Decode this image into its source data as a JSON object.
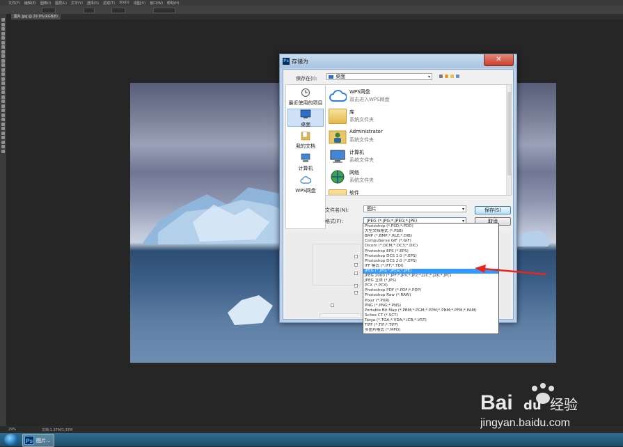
{
  "photoshop": {
    "menus": [
      "文件(F)",
      "编辑(E)",
      "图像(I)",
      "图层(L)",
      "文字(Y)",
      "选择(S)",
      "滤镜(T)",
      "3D(D)",
      "视图(V)",
      "窗口(W)",
      "帮助(H)"
    ],
    "doc_tab": "图片.jpg @ 29.9%(RGB/8)",
    "status_zoom": "29%",
    "status_doc": "文档:1.37M/1.37M"
  },
  "dialog": {
    "title": "存储为",
    "close_glyph": "✕",
    "save_in_label": "保存在(I):",
    "save_in_value": "桌面",
    "places": [
      {
        "label": "最近使用的项目",
        "icon": "recent-icon"
      },
      {
        "label": "桌面",
        "icon": "desktop-icon"
      },
      {
        "label": "我的文档",
        "icon": "documents-icon"
      },
      {
        "label": "计算机",
        "icon": "computer-icon"
      },
      {
        "label": "WPS网盘",
        "icon": "cloud-icon"
      }
    ],
    "files": [
      {
        "name": "WPS网盘",
        "desc": "双击进入WPS网盘",
        "icon": "cloud-icon"
      },
      {
        "name": "库",
        "desc": "系统文件夹",
        "icon": "library-icon"
      },
      {
        "name": "Administrator",
        "desc": "系统文件夹",
        "icon": "user-folder-icon"
      },
      {
        "name": "计算机",
        "desc": "系统文件夹",
        "icon": "computer-icon"
      },
      {
        "name": "网络",
        "desc": "系统文件夹",
        "icon": "network-icon"
      },
      {
        "name": "软件",
        "desc": "",
        "icon": "folder-icon"
      }
    ],
    "filename_label": "文件名(N):",
    "filename_value": "图片",
    "format_label": "格式(F):",
    "format_value": "JPEG (*.JPG;*.JPEG;*.JPE)",
    "save_button": "保存(S)",
    "cancel_button": "取消",
    "format_options": [
      "Photoshop (*.PSD;*.PDD)",
      "大型文档格式 (*.PSB)",
      "BMP (*.BMP;*.RLE;*.DIB)",
      "CompuServe GIF (*.GIF)",
      "Dicom (*.DCM;*.DC3;*.DIC)",
      "Photoshop EPS (*.EPS)",
      "Photoshop DCS 1.0 (*.EPS)",
      "Photoshop DCS 2.0 (*.EPS)",
      "IFF 格式 (*.IFF;*.TDI)",
      "JPEG (*.JPG;*.JPEG;*.JPE)",
      "JPEG 2000 (*.JPF;*.JPX;*.JP2;*.J2C;*.J2K;*.JPC)",
      "JPEG 立体 (*.JPS)",
      "PCX (*.PCX)",
      "Photoshop PDF (*.PDF;*.PDP)",
      "Photoshop Raw (*.RAW)",
      "Pixar (*.PXR)",
      "PNG (*.PNG;*.PNS)",
      "Portable Bit Map (*.PBM;*.PGM;*.PPM;*.PNM;*.PFM;*.PAM)",
      "Scitex CT (*.SCT)",
      "Targa (*.TGA;*.VDA;*.ICB;*.VST)",
      "TIFF (*.TIF;*.TIFF)",
      "多图片格式 (*.MPO)"
    ],
    "selected_option_index": 9
  },
  "taskbar": {
    "ps_label": "图片...",
    "ps_glyph": "Ps"
  },
  "watermark": {
    "brand": "Bai",
    "brand_suffix": "经验",
    "url": "jingyan.baidu.com"
  },
  "colors": {
    "selection": "#3399ff",
    "annotation_arrow": "#e8261c"
  }
}
